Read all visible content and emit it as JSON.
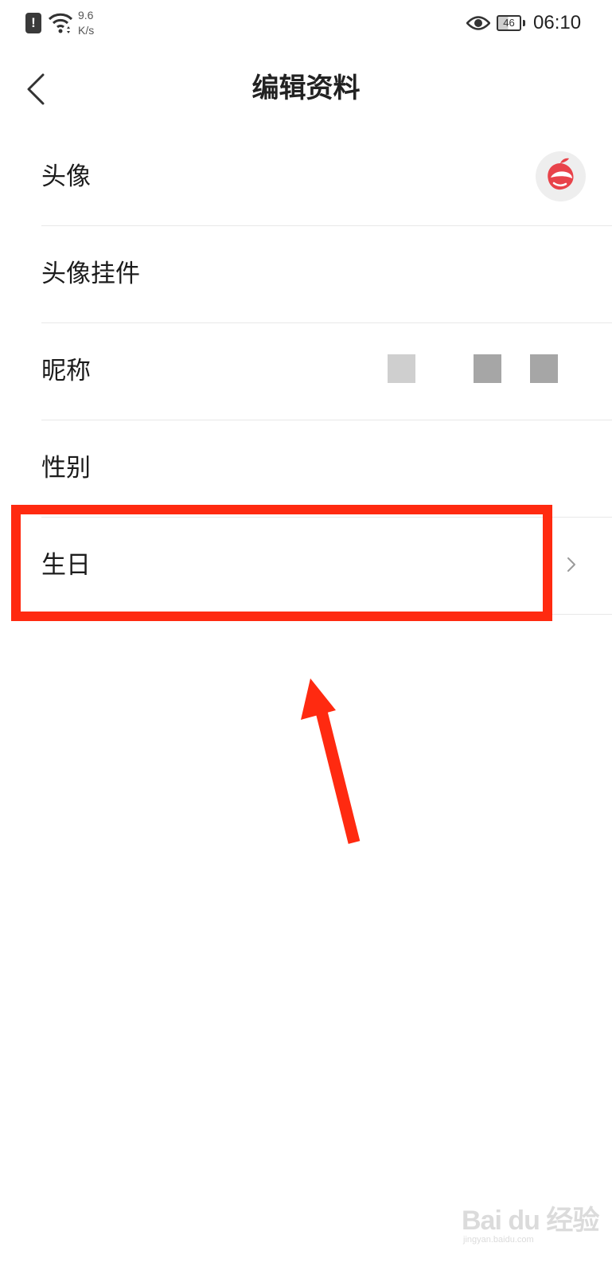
{
  "status_bar": {
    "alert_glyph": "!",
    "network_speed_value": "9.6",
    "network_speed_unit": "K/s",
    "battery_level": "46",
    "time": "06:10",
    "icons": [
      "alert-icon",
      "wifi-icon",
      "eye-icon",
      "battery-icon"
    ]
  },
  "header": {
    "title": "编辑资料",
    "back_icon": "chevron-left-icon"
  },
  "settings": {
    "items": [
      {
        "label": "头像"
      },
      {
        "label": "头像挂件"
      },
      {
        "label": "昵称"
      },
      {
        "label": "性别"
      },
      {
        "label": "生日"
      }
    ]
  },
  "avatar": {
    "icon": "red-apple-logo-icon",
    "accent_color": "#e8434a"
  },
  "nickname_mosaic": {
    "colors": [
      "#cfcfcf",
      "#a6a6a6",
      "#a6a6a6"
    ]
  },
  "annotation": {
    "highlight_color": "#ff2a10",
    "highlighted_item": "生日"
  },
  "watermark": {
    "brand": "Bai du 经验",
    "url": "jingyan.baidu.com"
  }
}
